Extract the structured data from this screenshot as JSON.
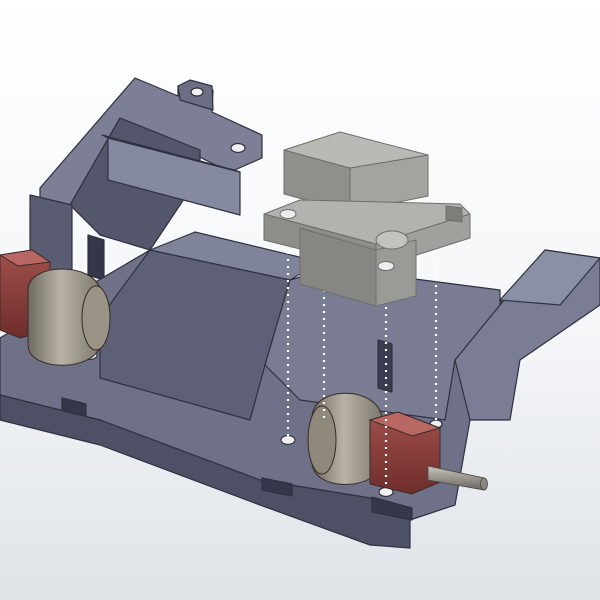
{
  "scene": {
    "view": "cad-3d-isometric-assembly",
    "components": [
      {
        "id": "chassis-frame",
        "kind": "housing"
      },
      {
        "id": "servo-block",
        "kind": "part",
        "state": "exploded"
      },
      {
        "id": "left-motor",
        "kind": "motor"
      },
      {
        "id": "right-motor",
        "kind": "motor"
      },
      {
        "id": "motor-shaft",
        "kind": "shaft"
      },
      {
        "id": "assembly-guide-lines",
        "kind": "dotted-lines",
        "count": 4
      }
    ],
    "colors": {
      "background_top": "#ffffff",
      "background_bottom": "#dfe3e8",
      "chassis_top": "#7c7f95",
      "chassis_side": "#5a5d72",
      "chassis_edge": "#2f3140",
      "servo_top": "#b4b4b0",
      "servo_side": "#8f8f8c",
      "motor_red": "#8c3c3a",
      "motor_red_dark": "#5e2726",
      "motor_can": "#a8a295",
      "guide_line": "#ffffff"
    }
  }
}
